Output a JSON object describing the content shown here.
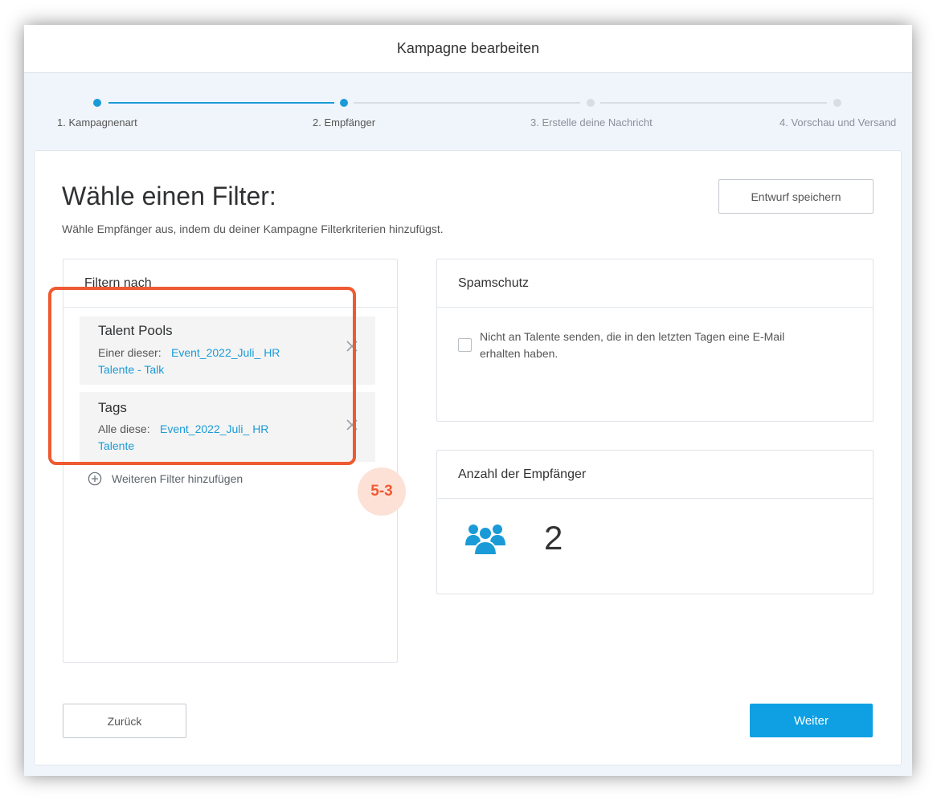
{
  "window": {
    "title": "Kampagne bearbeiten"
  },
  "stepper": {
    "steps": [
      {
        "label": "1. Kampagnenart",
        "state": "completed"
      },
      {
        "label": "2. Empfänger",
        "state": "active"
      },
      {
        "label": "3. Erstelle deine Nachricht",
        "state": "inactive"
      },
      {
        "label": "4. Vorschau und Versand",
        "state": "inactive"
      }
    ]
  },
  "page": {
    "heading": "Wähle einen Filter:",
    "subtitle": "Wähle Empfänger aus, indem du deiner Kampagne Filterkriterien hinzufügst.",
    "save_draft_label": "Entwurf speichern"
  },
  "filters_panel": {
    "title": "Filtern nach",
    "filters": [
      {
        "title": "Talent Pools",
        "prefix": "Einer dieser:",
        "value_line1": "Event_2022_Juli_ HR",
        "value_line2": "Talente - Talk"
      },
      {
        "title": "Tags",
        "prefix": "Alle diese:",
        "value_line1": "Event_2022_Juli_ HR",
        "value_line2": "Talente"
      }
    ],
    "add_filter_label": "Weiteren Filter hinzufügen"
  },
  "spam_panel": {
    "title": "Spamschutz",
    "checkbox_line1": "Nicht an Talente senden, die in den letzten Tagen eine E-Mail",
    "checkbox_line2": "erhalten haben.",
    "checked": false
  },
  "recipients_panel": {
    "title": "Anzahl der Empfänger",
    "count": "2",
    "icon": "users-icon"
  },
  "annotation": {
    "badge_label": "5-3",
    "color": "#ef5a32"
  },
  "footer": {
    "back_label": "Zurück",
    "next_label": "Weiter"
  },
  "colors": {
    "accent": "#1a9bd7",
    "primary_button": "#0ea0e2",
    "annotation": "#ef5a32"
  }
}
